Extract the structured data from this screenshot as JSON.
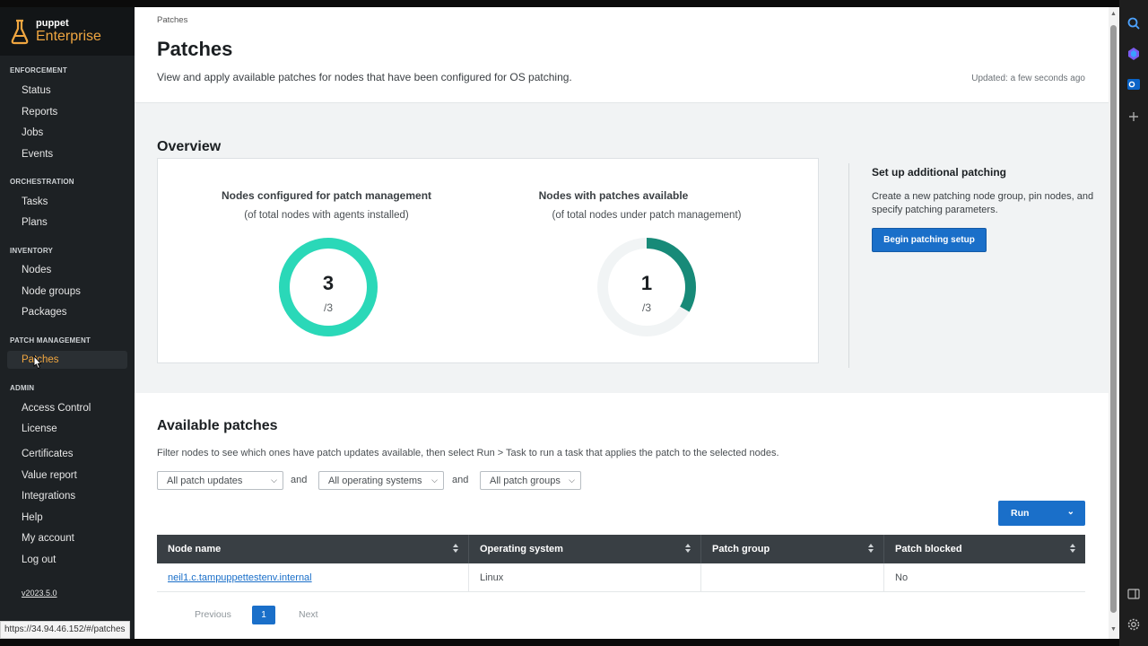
{
  "brand": {
    "small": "puppet",
    "big": "Enterprise"
  },
  "sidebar": {
    "sections": [
      {
        "title": "ENFORCEMENT",
        "items": [
          "Status",
          "Reports",
          "Jobs",
          "Events"
        ]
      },
      {
        "title": "ORCHESTRATION",
        "items": [
          "Tasks",
          "Plans"
        ]
      },
      {
        "title": "INVENTORY",
        "items": [
          "Nodes",
          "Node groups",
          "Packages"
        ]
      },
      {
        "title": "PATCH MANAGEMENT",
        "items": [
          "Patches"
        ]
      },
      {
        "title": "ADMIN",
        "items": [
          "Access Control",
          "License",
          "Certificates",
          "Value report",
          "Integrations",
          "Help",
          "My account",
          "Log out"
        ]
      }
    ],
    "active_item": "Patches",
    "version": "v2023.5.0"
  },
  "header": {
    "breadcrumb": "Patches",
    "title": "Patches",
    "description": "View and apply available patches for nodes that have been configured for OS patching.",
    "updated": "Updated: a few seconds ago"
  },
  "overview": {
    "title": "Overview",
    "metric1": {
      "title": "Nodes configured for patch management",
      "subtitle": "(of total nodes with agents installed)",
      "value": "3",
      "total": "/3",
      "fraction": 1.0,
      "color": "#2ad8b8"
    },
    "metric2": {
      "title": "Nodes with patches available",
      "subtitle": "(of total nodes under patch management)",
      "value": "1",
      "total": "/3",
      "fraction": 0.3333,
      "color": "#178a78"
    },
    "setup": {
      "title": "Set up additional patching",
      "description": "Create a new patching node group, pin nodes, and specify patching parameters.",
      "button": "Begin patching setup"
    }
  },
  "available": {
    "title": "Available patches",
    "description": "Filter nodes to see which ones have patch updates available, then select Run > Task to run a task that applies the patch to the selected nodes.",
    "filters": [
      "All patch updates",
      "All operating systems",
      "All patch groups"
    ],
    "and_label": "and",
    "run_label": "Run",
    "columns": [
      "Node name",
      "Operating system",
      "Patch group",
      "Patch blocked"
    ],
    "rows": [
      {
        "node": "neil1.c.tampuppettestenv.internal",
        "os": "Linux",
        "group": "",
        "blocked": "No"
      }
    ],
    "pager": {
      "prev": "Previous",
      "page": "1",
      "next": "Next"
    }
  },
  "status_url": "https://34.94.46.152/#/patches",
  "colors": {
    "accent": "#1a6fc9",
    "brand_orange": "#f0a640",
    "sidebar_bg": "#1d2124"
  }
}
